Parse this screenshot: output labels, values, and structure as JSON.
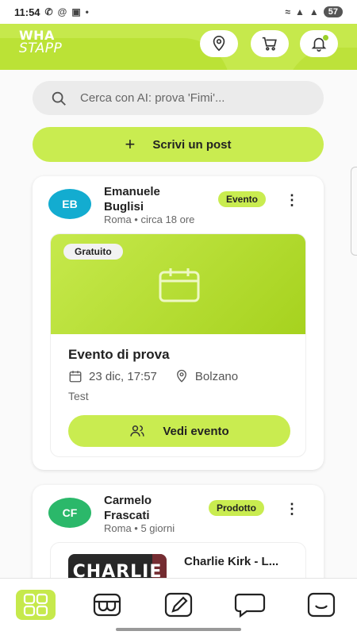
{
  "status_bar": {
    "time": "11:54",
    "battery": "57"
  },
  "header": {
    "logo_line1": "WHA",
    "logo_line2": "STAPP",
    "actions": [
      "location-pin-icon",
      "cart-icon",
      "bell-icon"
    ]
  },
  "search": {
    "placeholder": "Cerca con AI: prova 'Fimi'..."
  },
  "write_post": {
    "label": "Scrivi un post"
  },
  "posts": [
    {
      "initials": "EB",
      "author": "Emanuele Buglisi",
      "meta": "Roma • circa 18 ore",
      "badge": "Evento",
      "avatar_color": "#13acd0",
      "event": {
        "tag": "Gratuito",
        "title": "Evento di prova",
        "date": "23 dic, 17:57",
        "location": "Bolzano",
        "description": "Test",
        "cta": "Vedi evento"
      }
    },
    {
      "initials": "CF",
      "author": "Carmelo Frascati",
      "meta": "Roma • 5 giorni",
      "badge": "Prodotto",
      "avatar_color": "#2bb86a",
      "product": {
        "image_text": "CHARLIE",
        "title": "Charlie Kirk - L..."
      }
    }
  ],
  "bottom_nav": {
    "items": [
      "grid-icon",
      "shop-icon",
      "pencil-icon",
      "chat-icon",
      "smiley-icon"
    ],
    "active": 0
  },
  "colors": {
    "accent": "#c9ec50",
    "header": "#c6e94c"
  }
}
